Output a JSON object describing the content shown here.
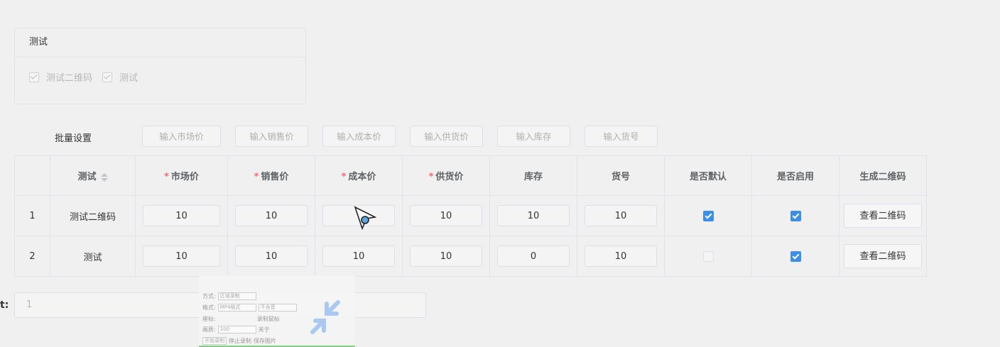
{
  "card": {
    "title": "测试",
    "options": [
      {
        "label": "测试二维码",
        "checked": true
      },
      {
        "label": "测试",
        "checked": true
      }
    ]
  },
  "batch": {
    "label": "批量设置",
    "buttons": [
      "输入市场价",
      "输入销售价",
      "输入成本价",
      "输入供货价",
      "输入库存",
      "输入货号"
    ]
  },
  "table": {
    "headers": {
      "index": "",
      "name": "测试",
      "market_price": "市场价",
      "sale_price": "销售价",
      "cost_price": "成本价",
      "supply_price": "供货价",
      "stock": "库存",
      "sku": "货号",
      "is_default": "是否默认",
      "is_enabled": "是否启用",
      "qr": "生成二维码"
    },
    "required_mark": "*",
    "qr_button_label": "查看二维码",
    "rows": [
      {
        "index": "1",
        "name": "测试二维码",
        "market_price": "10",
        "sale_price": "10",
        "cost_price": "",
        "supply_price": "10",
        "stock": "10",
        "sku": "10",
        "is_default": true,
        "is_enabled": true
      },
      {
        "index": "2",
        "name": "测试",
        "market_price": "10",
        "sale_price": "10",
        "cost_price": "10",
        "supply_price": "10",
        "stock": "0",
        "sku": "10",
        "is_default": false,
        "is_enabled": true
      }
    ]
  },
  "bottom": {
    "label": "t:",
    "value": "1"
  },
  "recorder_overlay": {
    "rows": [
      {
        "label": "方式:",
        "value": "区域录制"
      },
      {
        "label": "格式:",
        "value": "MP4格式",
        "extra": "不含音"
      },
      {
        "label": "座标:",
        "value": "",
        "extra": "录制鼠标"
      },
      {
        "label": "画质:",
        "value": "100",
        "extra": "关于"
      }
    ],
    "actions": [
      "开始录制",
      "停止录制",
      "保存图片"
    ]
  },
  "colors": {
    "accent": "#3d8fe6",
    "required": "#f56c6c",
    "border": "#e2e2ea",
    "background": "#f0f0f0"
  }
}
